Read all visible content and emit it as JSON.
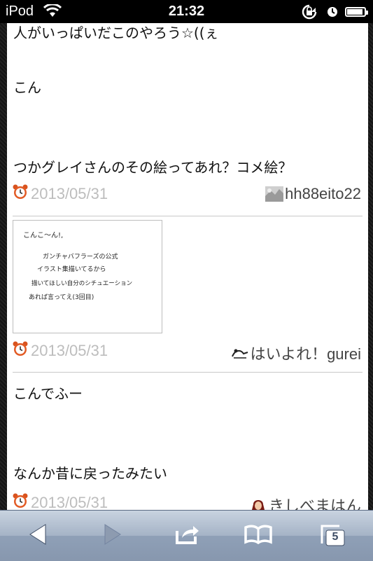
{
  "status_bar": {
    "carrier": "iPod",
    "time": "21:32",
    "battery_level": 0.9
  },
  "posts": [
    {
      "lines": [
        "人がいっぱいだこのやろう☆((ぇ",
        "こん",
        "つかグレイさんのその絵ってあれ？コメ絵？"
      ],
      "date": "2013/05/31",
      "user": "hh88eito22"
    },
    {
      "image_lines": [
        "こんこ～ん!,",
        "ガンチャバフラーズの公式",
        "イラスト集描いてるから",
        "描いてほしい自分のシチュエーション",
        "あれば言ってえ(3回目)"
      ],
      "date": "2013/05/31",
      "user": "はいよれ！gurei"
    },
    {
      "lines": [
        "こんでふー",
        "なんか昔に戻ったみたい"
      ],
      "date": "2013/05/31",
      "user": "きしべまはん"
    }
  ],
  "toolbar": {
    "tab_count": "5"
  },
  "colors": {
    "date": "#bdbdbd",
    "toolbar_top": "#c9d3e0",
    "toolbar_bottom": "#8797ae"
  }
}
